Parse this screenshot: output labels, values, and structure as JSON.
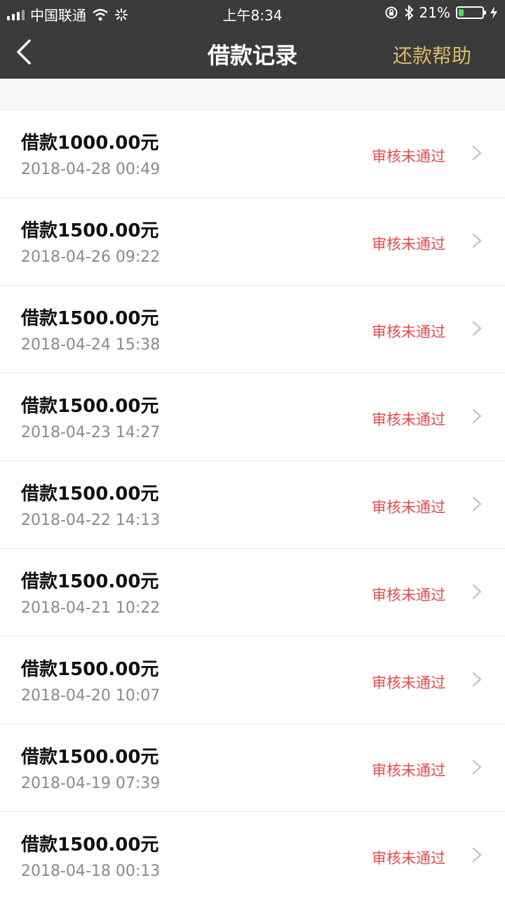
{
  "status_bar": {
    "carrier": "中国联通",
    "time": "上午8:34",
    "battery_percent": "21%",
    "battery_level": 0.21
  },
  "nav": {
    "title": "借款记录",
    "help_label": "还款帮助"
  },
  "records": [
    {
      "amount": "借款1000.00元",
      "date": "2018-04-28 00:49",
      "status": "审核未通过"
    },
    {
      "amount": "借款1500.00元",
      "date": "2018-04-26 09:22",
      "status": "审核未通过"
    },
    {
      "amount": "借款1500.00元",
      "date": "2018-04-24 15:38",
      "status": "审核未通过"
    },
    {
      "amount": "借款1500.00元",
      "date": "2018-04-23 14:27",
      "status": "审核未通过"
    },
    {
      "amount": "借款1500.00元",
      "date": "2018-04-22 14:13",
      "status": "审核未通过"
    },
    {
      "amount": "借款1500.00元",
      "date": "2018-04-21 10:22",
      "status": "审核未通过"
    },
    {
      "amount": "借款1500.00元",
      "date": "2018-04-20 10:07",
      "status": "审核未通过"
    },
    {
      "amount": "借款1500.00元",
      "date": "2018-04-19 07:39",
      "status": "审核未通过"
    },
    {
      "amount": "借款1500.00元",
      "date": "2018-04-18 00:13",
      "status": "审核未通过"
    }
  ],
  "colors": {
    "header_bg": "#3b3b3b",
    "help_accent": "#d9b96b",
    "status_red": "#e64a4a"
  }
}
